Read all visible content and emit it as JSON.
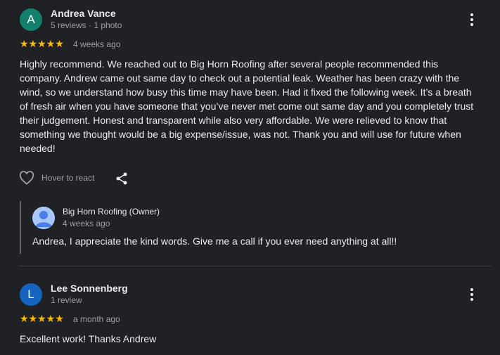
{
  "reviews": [
    {
      "avatar_letter": "A",
      "avatar_color": "#12806b",
      "name": "Andrea Vance",
      "meta": "5 reviews · 1 photo",
      "stars": "★★★★★",
      "rating": 5,
      "time": "4 weeks ago",
      "text": "Highly recommend. We reached out to Big Horn Roofing after several people recommended this company. Andrew came out same day to check out a potential leak. Weather has been crazy with the wind, so we understand how busy this time may have been. Had it fixed the following week. It’s a breath of fresh air when you have someone that you’ve never met come out same day and you completely trust their judgement. Honest and transparent while also very affordable. We were relieved to know that something we thought would be a big expense/issue, was not. Thank you and will use for future when needed!",
      "react_label": "Hover to react",
      "owner_reply": {
        "name": "Big Horn Roofing (Owner)",
        "time": "4 weeks ago",
        "text": "Andrea, I appreciate the kind words. Give me a call if you ever need anything at all!!"
      }
    },
    {
      "avatar_letter": "L",
      "avatar_color": "#1565c0",
      "name": "Lee Sonnenberg",
      "meta": "1 review",
      "stars": "★★★★★",
      "rating": 5,
      "time": "a month ago",
      "text": "Excellent work! Thanks Andrew"
    }
  ],
  "icons": {
    "more": "more-vert-icon",
    "heart": "heart-outline-icon",
    "share": "share-icon",
    "owner_avatar": "person-avatar-icon"
  }
}
